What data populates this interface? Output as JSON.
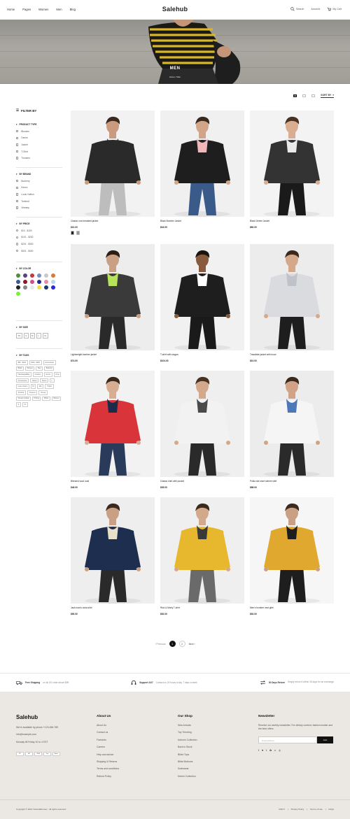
{
  "header": {
    "nav": [
      "Home",
      "Pages",
      "Women",
      "Men",
      "Blog"
    ],
    "logo": "Salehub",
    "search_label": "Search",
    "account_label": "Account",
    "cart_label": "My Cart"
  },
  "hero": {
    "title": "MEN",
    "breadcrumb": "Home / Men"
  },
  "toolbar": {
    "sort_label": "SORT BY"
  },
  "sidebar": {
    "title": "FILTER BY",
    "product_type": {
      "title": "PRODUCT TYPE",
      "items": [
        "Blouses",
        "Denim",
        "Jacket",
        "T-Shirt",
        "Trousers"
      ]
    },
    "brand": {
      "title": "BY BRAND",
      "items": [
        "Burberry",
        "Kenzo",
        "Louis Vuitton",
        "Tomford",
        "Vinesep"
      ]
    },
    "price": {
      "title": "BY PRICE",
      "items": [
        "$10 - $100",
        "$101 - $200",
        "$201 - $300",
        "$301 - $400"
      ]
    },
    "color": {
      "title": "BY COLOR",
      "swatches": [
        "#4a8f3a",
        "#5b3f8a",
        "#c03a3a",
        "#7a8fc0",
        "#c8c8c8",
        "#d87a3a",
        "#3a5a9a",
        "#8a1a2a",
        "#d84a8a",
        "#2a2a8a",
        "#e88aa8",
        "#b8d8e8",
        "#222222",
        "#888888",
        "#e8e8e8",
        "#f0e040",
        "#1a3a6a",
        "#2a2ad8",
        "#7af03a"
      ]
    },
    "size": {
      "title": "BY SIZE",
      "items": [
        "XS",
        "S",
        "M",
        "L",
        "XL"
      ]
    },
    "tags": {
      "title": "BY TAGS",
      "items": [
        "$50 - $100",
        "$100 - $200",
        "Accessories",
        "Black",
        "Women",
        "Men",
        "Bottoms",
        "Handbags&Bag",
        "Outdoor",
        "Denim",
        "Drop",
        "Accessories",
        "Jacket",
        "Sweet",
        "L",
        "Louis Vuitton",
        "M",
        "Mtn",
        "T-Shirt",
        "Tomford",
        "Trousers",
        "Vinesp",
        "Vinesp Limited",
        "Pricing",
        "White",
        "Women",
        "S",
        "XL"
      ]
    }
  },
  "products": [
    {
      "name": "Classic one-breasted jacket",
      "price": "$21.00",
      "bg": "#f2f2f2",
      "top": "#2a2a2a",
      "bottom": "#bdbdbd",
      "skin": "#c99a7d",
      "hair": "#3a2a1e",
      "accent": "#2a2a2a"
    },
    {
      "name": "Black Bomber Jacket",
      "price": "$16.00",
      "bg": "#f0f0f0",
      "top": "#1e1e1e",
      "bottom": "#3a5a8a",
      "skin": "#d2a588",
      "hair": "#3a2a1e",
      "accent": "#f1b7b8"
    },
    {
      "name": "Black Denim Jacket",
      "price": "$60.00",
      "bg": "#f3f3f3",
      "top": "#333333",
      "bottom": "#1a1a1a",
      "skin": "#d8ad92",
      "hair": "#4a3222",
      "accent": "#eaeaea"
    },
    {
      "name": "Lightweight bomber jacket",
      "price": "$74.00",
      "bg": "#ededed",
      "top": "#3a3a3a",
      "bottom": "#2a2a2a",
      "skin": "#caa084",
      "hair": "#2a1e16",
      "accent": "#b7e35a"
    },
    {
      "name": "T-shirt with slogan",
      "price": "$104.00",
      "bg": "#f1f1f1",
      "top": "#1e1e1e",
      "bottom": "#1a1a1a",
      "skin": "#8a5a3e",
      "hair": "#1a1410",
      "accent": "#ffffff"
    },
    {
      "name": "Travaliste jacket with hood",
      "price": "$10.00",
      "bg": "#ececec",
      "top": "#d9dbdf",
      "bottom": "#1e1e1e",
      "skin": "#d4a88b",
      "hair": "#3a2a1e",
      "accent": "#bfc3c9"
    },
    {
      "name": "Blended wool coat",
      "price": "$48.00",
      "bg": "#f2f2f2",
      "top": "#d8343a",
      "bottom": "#2a3a5a",
      "skin": "#d8ae92",
      "hair": "#3a2a1e",
      "accent": "#1e2a4a"
    },
    {
      "name": "Classic shirt with pocket",
      "price": "$35.00",
      "bg": "#efefef",
      "top": "#f2f2f2",
      "bottom": "#2a2a2a",
      "skin": "#d4a88b",
      "hair": "#4a3222",
      "accent": "#4a4a4a"
    },
    {
      "name": "Polka dot short sleeve shirt",
      "price": "$88.00",
      "bg": "#ececec",
      "top": "#f5f5f5",
      "bottom": "#2a2a2a",
      "skin": "#d2a286",
      "hair": "#3a2a1e",
      "accent": "#4a78b8"
    },
    {
      "name": "Jack man's cuba shirt",
      "price": "$90.00",
      "bg": "#eeeeee",
      "top": "#1e2e4e",
      "bottom": "#2a2a2a",
      "skin": "#caa084",
      "hair": "#3a2a1e",
      "accent": "#e8e0c8"
    },
    {
      "name": "Rick & Morty T-shirt",
      "price": "$92.00",
      "bg": "#efefef",
      "top": "#e7b82e",
      "bottom": "#6a6a6a",
      "skin": "#d4a88b",
      "hair": "#3a2a1e",
      "accent": "#3a3a3a"
    },
    {
      "name": "Men's bomber vest gilet",
      "price": "$92.00",
      "bg": "#f6f6f6",
      "top": "#e0a82e",
      "bottom": "#1e1e1e",
      "skin": "#caa084",
      "hair": "#3a2a1e",
      "accent": "#1e1e1e"
    }
  ],
  "pagination": {
    "prev": "Previous",
    "pages": [
      "1",
      "2"
    ],
    "current": "1",
    "next": "Next"
  },
  "services": [
    {
      "title": "Free Shipping",
      "text": "on all US order above $99"
    },
    {
      "title": "Support 24/7",
      "text": "Contact us 24 hours a day, 7 days a week"
    },
    {
      "title": "30 Days Return",
      "text": "Simply return it within 30 days for an exchange"
    }
  ],
  "footer": {
    "logo": "Salehub",
    "contact": [
      "We're available by phone +123-456-789",
      "info@example.com",
      "Monday till Friday 10 to 4 EST"
    ],
    "payments": [
      "PP",
      "MC",
      "VISA",
      "Pay",
      "Amex"
    ],
    "about": {
      "title": "About Us",
      "items": [
        "About Us",
        "Contact us",
        "Factories",
        "Careers",
        "Help and advice",
        "Shipping & Returns",
        "Terms and conditions",
        "Refund Policy"
      ]
    },
    "shop": {
      "title": "Our Shop",
      "items": [
        "New Arrivals",
        "Top Trending",
        "Autumn Collection",
        "Back in Stock",
        "Bikini Tops",
        "Bikini Bottoms",
        "Swimwear",
        "Denim Collection"
      ]
    },
    "newsletter": {
      "title": "Newsletter",
      "text": "Receive our weekly newsletter. For dietary content, fashion insider and the best offers.",
      "placeholder": "Email address",
      "button": "Join"
    },
    "social": [
      "f",
      "♥",
      "t",
      "✿",
      "v",
      "◎"
    ],
    "copyright": "Copyright © 2021 Visionalthemes . All rights reserved.",
    "currency": "USD",
    "links": [
      "Privacy Policy",
      "Terms of Use",
      "FAQs"
    ]
  }
}
